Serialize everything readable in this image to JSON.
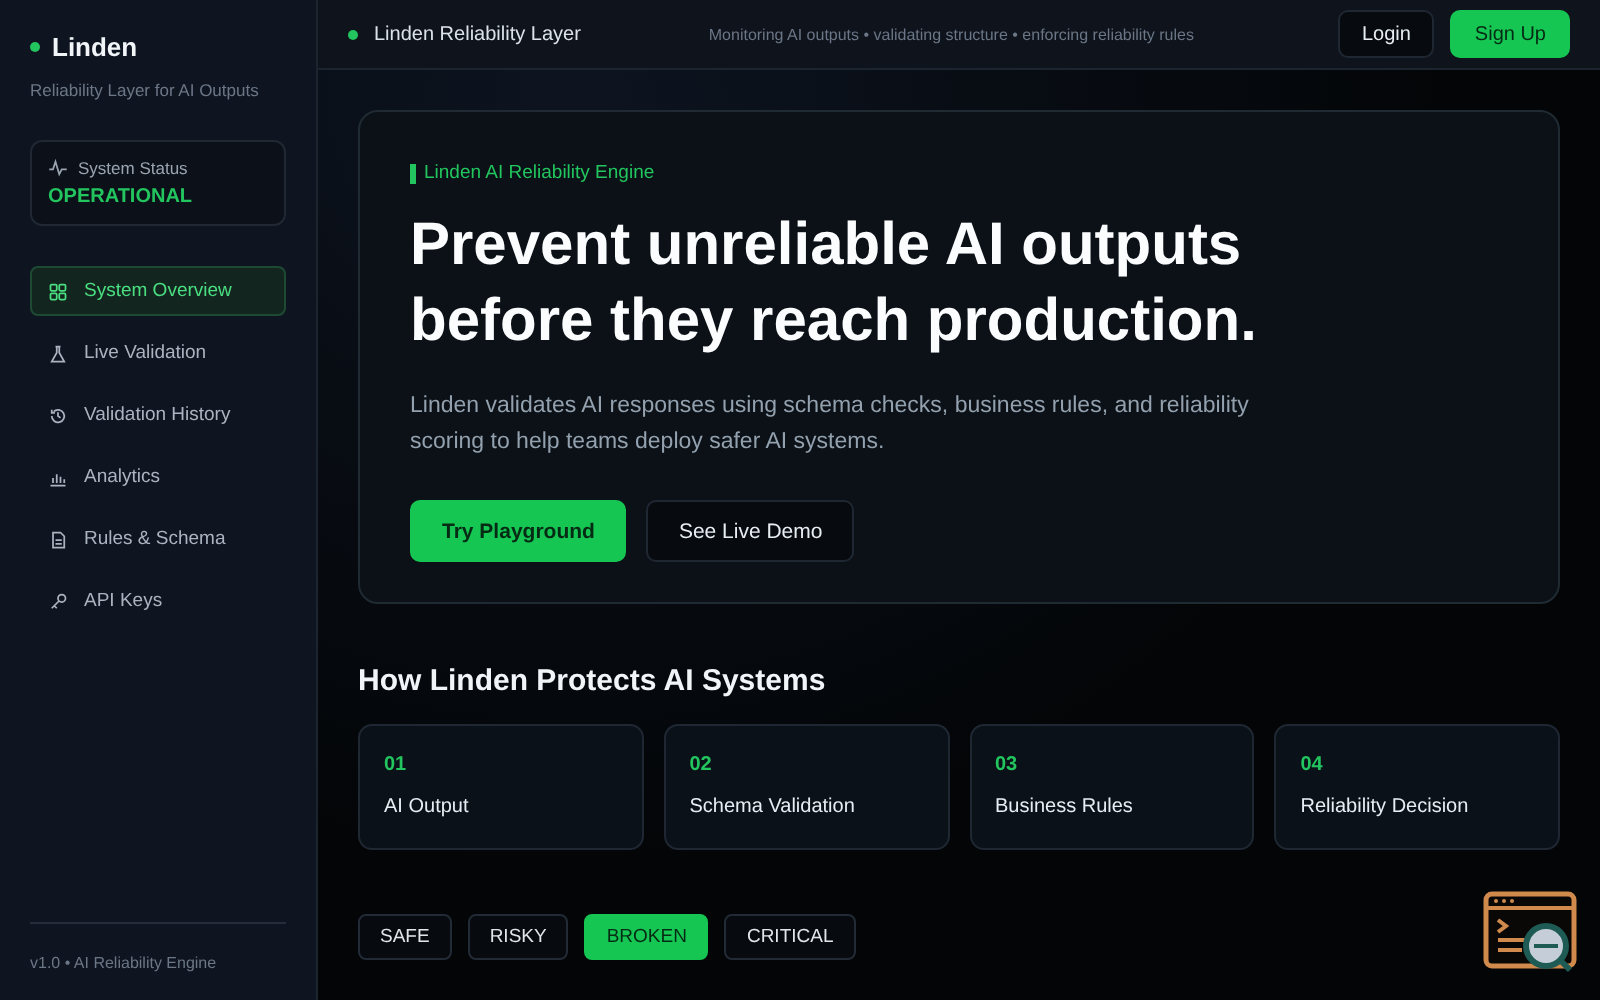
{
  "sidebar": {
    "brand": "Linden",
    "tagline": "Reliability Layer for AI Outputs",
    "status": {
      "label": "System Status",
      "value": "OPERATIONAL"
    },
    "items": [
      {
        "label": "System Overview",
        "selected": true
      },
      {
        "label": "Live Validation",
        "selected": false
      },
      {
        "label": "Validation History",
        "selected": false
      },
      {
        "label": "Analytics",
        "selected": false
      },
      {
        "label": "Rules & Schema",
        "selected": false
      },
      {
        "label": "API Keys",
        "selected": false
      }
    ],
    "footer": "v1.0 • AI Reliability Engine"
  },
  "topbar": {
    "title": "Linden Reliability Layer",
    "ticker": "Monitoring AI outputs • validating structure • enforcing reliability rules",
    "buttons": [
      {
        "label": "Login",
        "kind": "ghost"
      },
      {
        "label": "Sign Up",
        "kind": "primary"
      }
    ]
  },
  "hero": {
    "eyebrow": "Linden AI Reliability Engine",
    "heading": "Prevent unreliable AI outputs before they reach production.",
    "body": "Linden validates AI responses using schema checks, business rules, and reliability scoring to help teams deploy safer AI systems.",
    "buttons": [
      {
        "label": "Try Playground",
        "kind": "primary"
      },
      {
        "label": "See Live Demo",
        "kind": "ghost"
      }
    ]
  },
  "steps": {
    "heading": "How Linden Protects AI Systems",
    "items": [
      {
        "number": "01",
        "label": "AI Output"
      },
      {
        "number": "02",
        "label": "Schema Validation"
      },
      {
        "number": "03",
        "label": "Business Rules"
      },
      {
        "number": "04",
        "label": "Reliability Decision"
      }
    ]
  },
  "filters": [
    {
      "label": "SAFE",
      "selected": false
    },
    {
      "label": "RISKY",
      "selected": false
    },
    {
      "label": "BROKEN",
      "selected": true
    },
    {
      "label": "CRITICAL",
      "selected": false
    }
  ]
}
